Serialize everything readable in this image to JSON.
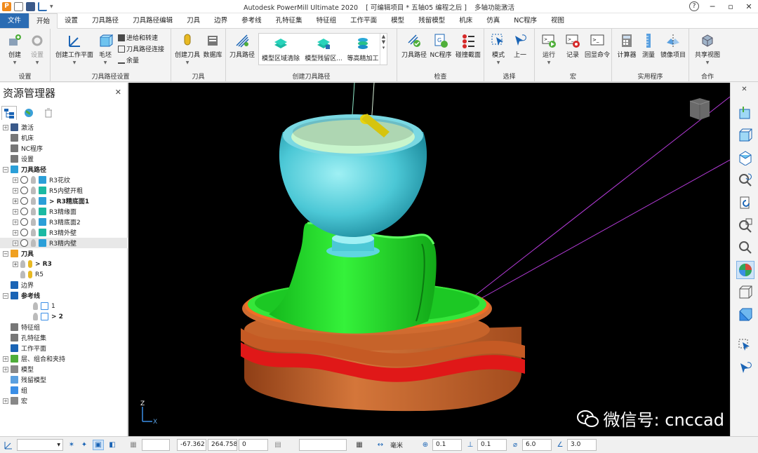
{
  "titlebar": {
    "app": "Autodesk PowerMill Ultimate 2020",
    "project": "[ 可编辑项目 * 五轴05 编程之后 ]",
    "mode": "多轴功能激活",
    "help": "?",
    "minimize": "─",
    "restore": "▫",
    "close": "✕"
  },
  "menu_tabs": [
    "文件",
    "开始",
    "设置",
    "刀具路径",
    "刀具路径编辑",
    "刀具",
    "边界",
    "参考线",
    "孔特征集",
    "特征组",
    "工作平面",
    "模型",
    "残留模型",
    "机床",
    "仿真",
    "NC程序",
    "视图"
  ],
  "ribbon": {
    "groups": {
      "settings": "设置",
      "toolpath_setup": "刀具路径设置",
      "tools": "刀具",
      "create_toolpath": "创建刀具路径",
      "verify": "检查",
      "select": "选择",
      "macro": "宏",
      "utilities": "实用程序",
      "collab": "合作"
    },
    "buttons": {
      "create": "创建",
      "settings": "设置",
      "create_workplane": "创建工作平面",
      "block": "毛坯",
      "feeds_speeds": "进给和转速",
      "toolpath_connections": "刀具路径连接",
      "allowance": "余量",
      "create_tool": "创建刀具",
      "database": "数据库",
      "toolpath": "刀具路径",
      "model_area_clear": "模型区域清除",
      "model_rest_area": "模型残留区...",
      "constant_z_finish": "等高精加工",
      "toolpath_verify": "刀具路径",
      "nc_program": "NC程序",
      "collision_section": "碰撞截面",
      "mode": "模式",
      "previous": "上一",
      "run": "运行",
      "record": "记录",
      "echo": "回显命令",
      "calculator": "计算器",
      "measure": "测量",
      "mirror": "镜像项目",
      "share_view": "共享视图"
    }
  },
  "explorer": {
    "title": "资源管理器",
    "close": "✕",
    "tree": [
      {
        "label": "激活",
        "level": 0,
        "pm": "+"
      },
      {
        "label": "机床",
        "level": 0,
        "pm": ""
      },
      {
        "label": "NC程序",
        "level": 0,
        "pm": ""
      },
      {
        "label": "设置",
        "level": 0,
        "pm": ""
      },
      {
        "label": "刀具路径",
        "level": 0,
        "pm": "−",
        "bold": true
      },
      {
        "label": "R3花纹",
        "level": 1,
        "pm": "+"
      },
      {
        "label": "R5内壁开粗",
        "level": 1,
        "pm": "+"
      },
      {
        "label": "> R3精底面1",
        "level": 1,
        "pm": "+",
        "bold": true
      },
      {
        "label": "R3精缘面",
        "level": 1,
        "pm": "+"
      },
      {
        "label": "R3精底面2",
        "level": 1,
        "pm": "+"
      },
      {
        "label": "R3精外壁",
        "level": 1,
        "pm": "+"
      },
      {
        "label": "R3精内壁",
        "level": 1,
        "pm": "+",
        "hl": true
      },
      {
        "label": "刀具",
        "level": 0,
        "pm": "−",
        "bold": true
      },
      {
        "label": "> R3",
        "level": 1,
        "pm": "+",
        "bold": true
      },
      {
        "label": "R5",
        "level": 1,
        "pm": ""
      },
      {
        "label": "边界",
        "level": 0,
        "pm": ""
      },
      {
        "label": "参考线",
        "level": 0,
        "pm": "−",
        "bold": true
      },
      {
        "label": "1",
        "level": 2,
        "pm": ""
      },
      {
        "label": "> 2",
        "level": 2,
        "pm": "",
        "bold": true
      },
      {
        "label": "特征组",
        "level": 0,
        "pm": ""
      },
      {
        "label": "孔特征集",
        "level": 0,
        "pm": ""
      },
      {
        "label": "工作平面",
        "level": 0,
        "pm": ""
      },
      {
        "label": "层、组合和夹持",
        "level": 0,
        "pm": "+"
      },
      {
        "label": "模型",
        "level": 0,
        "pm": "+"
      },
      {
        "label": "残留模型",
        "level": 0,
        "pm": ""
      },
      {
        "label": "组",
        "level": 0,
        "pm": ""
      },
      {
        "label": "宏",
        "level": 0,
        "pm": "+"
      }
    ]
  },
  "viewport": {
    "axis_z": "Z",
    "axis_x": "X",
    "watermark": "微信号: cnccad"
  },
  "statusbar": {
    "x": "-67.362",
    "y": "264.758",
    "z": "0",
    "units": "毫米",
    "tolerance": "0.1",
    "thickness": "0.1",
    "tool_diameter": "6.0",
    "tip_radius": "3.0"
  },
  "colors": {
    "file_tab": "#2b6cb3",
    "accent": "#1a64b5",
    "viewport_bg": "#000000",
    "part_green": "#22e02a",
    "part_cyan": "#5fd6e0",
    "base_orange": "#c6632a",
    "groove_red": "#e01818",
    "toolpath_magenta": "#b23ad6"
  }
}
